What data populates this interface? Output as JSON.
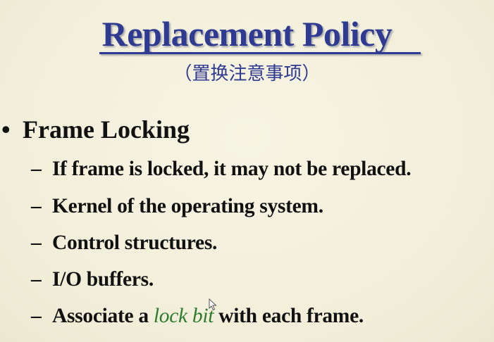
{
  "slide": {
    "title": "Replacement Policy",
    "subtitle": "（置换注意事项）",
    "bullet": {
      "marker": "•",
      "text": "Frame Locking"
    },
    "subbullets": [
      {
        "marker": "–",
        "text": "If frame is locked, it may not be replaced."
      },
      {
        "marker": "–",
        "text": "Kernel of the operating system."
      },
      {
        "marker": "–",
        "text": "Control structures."
      },
      {
        "marker": "–",
        "text": "I/O buffers."
      },
      {
        "marker": "–",
        "before": "Associate a ",
        "emphasis": "lock bit",
        "after": " with each frame."
      }
    ]
  },
  "colors": {
    "title": "#2f3a92",
    "emphasis": "#2e7b2e",
    "background": "#f4f1de"
  },
  "icons": [
    "mouse-pointer-icon"
  ]
}
